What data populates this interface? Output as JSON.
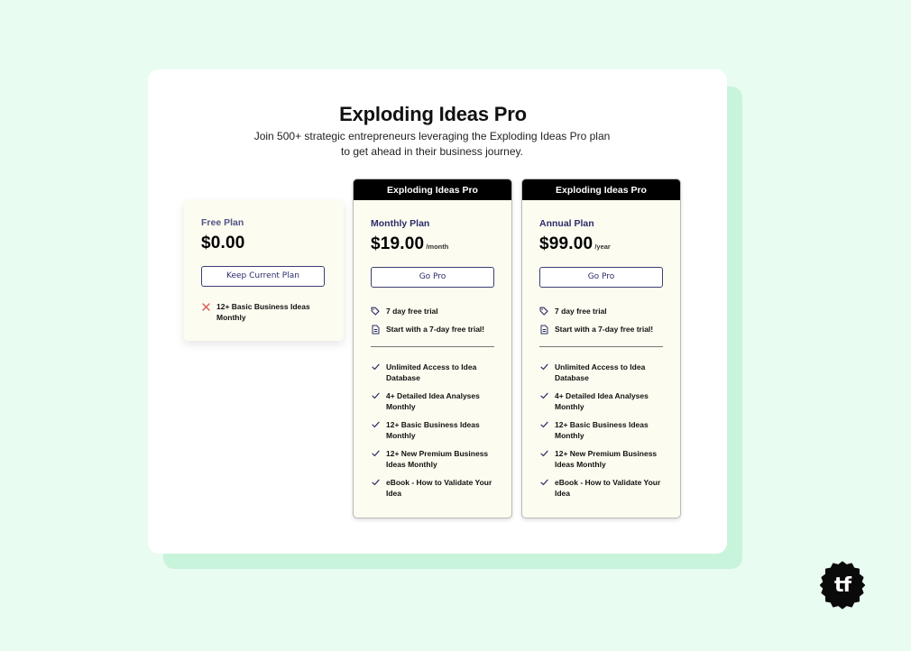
{
  "header": {
    "title": "Exploding Ideas Pro",
    "subtitle": "Join 500+ strategic entrepreneurs leveraging the Exploding Ideas Pro plan to get ahead in their business journey."
  },
  "plans": {
    "free": {
      "name": "Free Plan",
      "price": "$0.00",
      "button_label": "Keep Current Plan",
      "features": [
        {
          "icon": "x-icon",
          "text": "12+ Basic Business Ideas Monthly"
        }
      ]
    },
    "monthly": {
      "header": "Exploding Ideas Pro",
      "name": "Monthly Plan",
      "price": "$19.00",
      "period": "/month",
      "button_label": "Go Pro",
      "trial": [
        {
          "icon": "tag-icon",
          "text": "7 day free trial"
        },
        {
          "icon": "document-icon",
          "text": "Start with a 7-day free trial!"
        }
      ],
      "features": [
        "Unlimited Access to Idea Database",
        "4+ Detailed Idea Analyses Monthly",
        "12+ Basic Business Ideas Monthly",
        "12+ New Premium Business Ideas Monthly",
        "eBook - How to Validate Your Idea"
      ]
    },
    "annual": {
      "header": "Exploding Ideas Pro",
      "name": "Annual Plan",
      "price": "$99.00",
      "period": "/year",
      "button_label": "Go Pro",
      "trial": [
        {
          "icon": "tag-icon",
          "text": "7 day free trial"
        },
        {
          "icon": "document-icon",
          "text": "Start with a 7-day free trial!"
        }
      ],
      "features": [
        "Unlimited Access to Idea Database",
        "4+ Detailed Idea Analyses Monthly",
        "12+ Basic Business Ideas Monthly",
        "12+ New Premium Business Ideas Monthly",
        "eBook - How to Validate Your Idea"
      ]
    }
  },
  "logo": {
    "text": "tf",
    "icon": "badge-logo"
  },
  "colors": {
    "background": "#e9fcf1",
    "shadow_panel": "#c9f4dc",
    "card": "#fdfcf0",
    "accent": "#2a2c6b",
    "x_mark": "#d9534f"
  }
}
